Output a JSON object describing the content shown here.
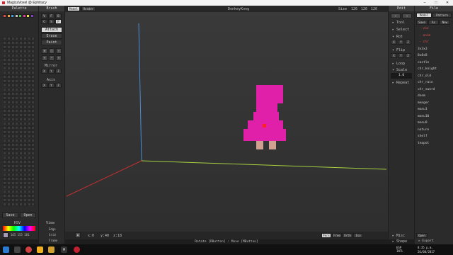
{
  "window": {
    "title": "MagicaVoxel @ Ephtracy"
  },
  "palette": {
    "header": "Palette",
    "top_swatches": [
      "#e05050",
      "#f0a040",
      "#40a0e0",
      "#c8c8c8",
      "#50c050",
      "#e040a0",
      "#f0e040",
      "#8040c0"
    ],
    "buttons": {
      "save": "Save",
      "open": "Open"
    },
    "hsv_label": "HSV",
    "rgb_value": "165 155 181"
  },
  "brush": {
    "header": "Brush",
    "modes": [
      "V",
      "F",
      "B",
      "C",
      "S",
      "P"
    ],
    "actions": {
      "attach": "Attach",
      "erase": "Erase",
      "paint": "Paint"
    },
    "mirror_label": "Mirror",
    "axis_label": "Axis",
    "axis_buttons": [
      "X",
      "Y",
      "Z"
    ]
  },
  "viewport": {
    "tabs": {
      "model": "Model",
      "render": "Render"
    },
    "model_name": "DonkeyKong",
    "size_label": "Size",
    "size_values": [
      "126",
      "126",
      "126"
    ],
    "coords": {
      "x": "x:0",
      "y": "y:40",
      "z": "z:18"
    },
    "status_text": "Rotate [RButton] : Move [MButton]",
    "view_modes": [
      "Pers",
      "Free",
      "Orth",
      "Iso"
    ],
    "view_label": "View",
    "view_options": [
      "Edge",
      "Grid",
      "Frame"
    ],
    "colors": {
      "figure": "#e020a8",
      "feet": "#d0a090",
      "axis_y": "#4a8ad0",
      "axis_x": "#a8d040",
      "axis_z": "#c03030"
    }
  },
  "edit": {
    "header": "Edit",
    "tool_label": "Tool",
    "select_label": "Select",
    "rot_label": "Rot",
    "flip_label": "Flip",
    "loop_label": "Loop",
    "scale_label": "Scale",
    "scale_value": "1.0",
    "repeat_label": "Repeat",
    "axis_buttons": [
      "X",
      "Y",
      "Z"
    ],
    "misc_label": "Misc",
    "shape_label": "Shape"
  },
  "file": {
    "header": "File",
    "tabs": {
      "model": "Model",
      "pattern": "Pattern"
    },
    "actions": {
      "save_as": "Save",
      "as": "As",
      "new": "New"
    },
    "items": [
      "vox",
      "anim",
      "chr",
      "3x3x3",
      "8x8x8",
      "castle",
      "chr_knight",
      "chr_old",
      "chr_rain",
      "chr_sword",
      "doom",
      "menger",
      "monu1",
      "monu10",
      "monu9",
      "nature",
      "shelf",
      "teapot"
    ],
    "open_label": "Open",
    "export_label": "Export"
  },
  "taskbar": {
    "lang": "ESP\nINTL",
    "time": "8:35 p.m.",
    "date": "26/08/2017"
  }
}
